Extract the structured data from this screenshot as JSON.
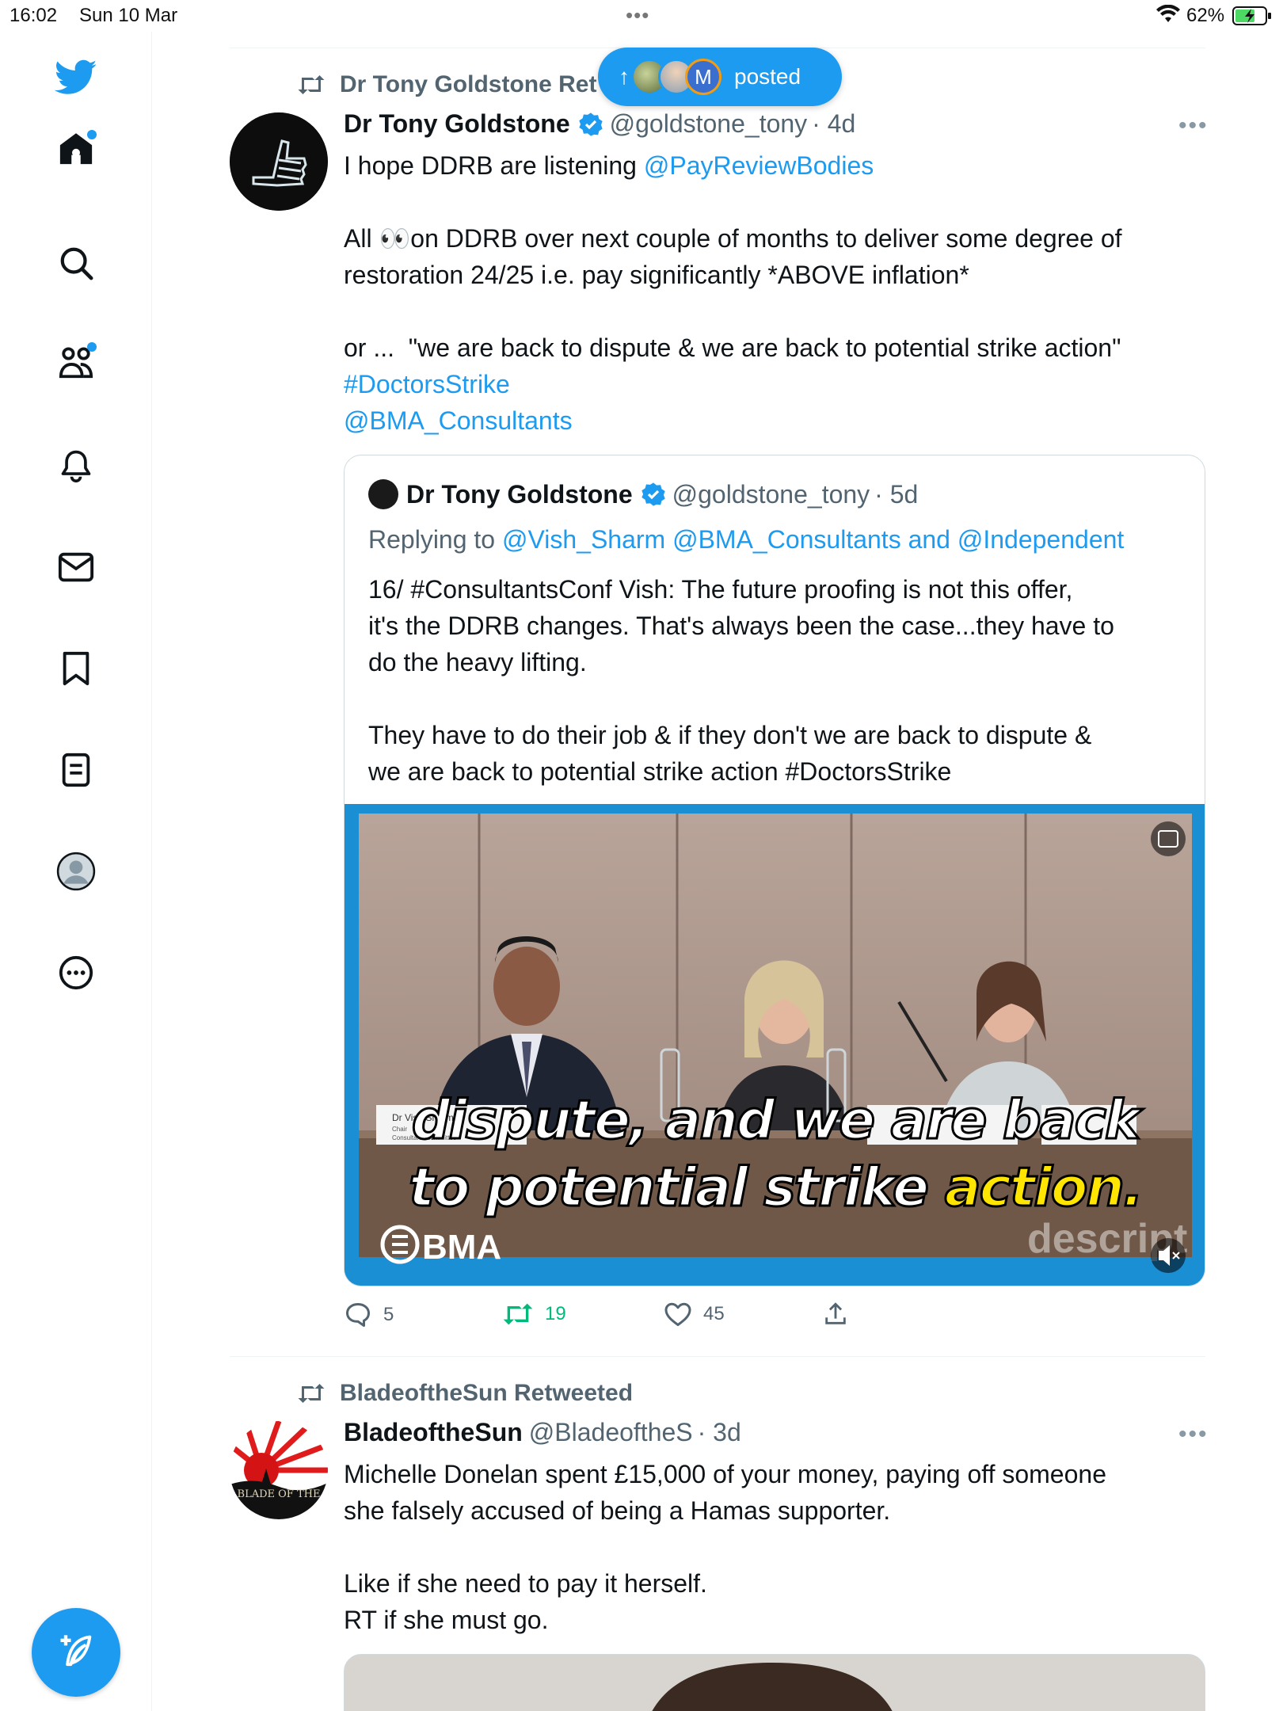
{
  "status_bar": {
    "time": "16:02",
    "date": "Sun 10 Mar",
    "battery": "62%"
  },
  "new_posts_pill": {
    "label": "posted",
    "avatar_letter": "M"
  },
  "tweet1": {
    "retweeted_by": "Dr Tony Goldstone Ret",
    "author_name": "Dr Tony Goldstone",
    "handle": "@goldstone_tony",
    "age": "· 4d",
    "line1_text": "I hope DDRB are listening ",
    "line1_mention": "@PayReviewBodies",
    "para2": "All 👀on DDRB over next couple of months to deliver some degree of\nrestoration 24/25 i.e. pay significantly *ABOVE inflation*",
    "para3": "or ...  \"we are back to dispute & we are back to potential strike action\"",
    "hashtag": "#DoctorsStrike",
    "mention2": "@BMA_Consultants",
    "quote": {
      "author_name": "Dr Tony Goldstone",
      "handle": "@goldstone_tony",
      "age": "· 5d",
      "replying_prefix": "Replying to ",
      "replying_to": "@Vish_Sharm @BMA_Consultants and @Independent",
      "text": "16/ #ConsultantsConf Vish: The future proofing is not this offer,\nit's the DDRB changes. That's always been the case...they have to\ndo the heavy lifting.\n\nThey have to do their job & if they don't we are back to dispute &\nwe are back to potential strike action #DoctorsStrike",
      "video": {
        "caption_line1": "dispute, and we are back",
        "caption_line2_white": "to potential strike ",
        "caption_line2_yellow": "action.",
        "logo": "BMA",
        "watermark": "descript",
        "nameplate_name": "Dr Vish Sharma",
        "nameplate_role": "Chair",
        "nameplate_committee": "Consultants committee"
      }
    },
    "counts": {
      "replies": "5",
      "retweets": "19",
      "likes": "45"
    }
  },
  "tweet2": {
    "retweeted_by": "BladeoftheSun Retweeted",
    "author_name": "BladeoftheSun",
    "handle": "@BladeoftheS",
    "age": "· 3d",
    "text": "Michelle Donelan spent £15,000 of your money, paying off someone\nshe falsely accused of being a Hamas supporter.\n\nLike if she need to pay it herself.\nRT if she must go.",
    "avatar_text": "BLADE OF THE"
  },
  "colors": {
    "accent": "#1d9bf0",
    "retweet_green": "#00ba7c",
    "secondary_text": "#536471"
  }
}
